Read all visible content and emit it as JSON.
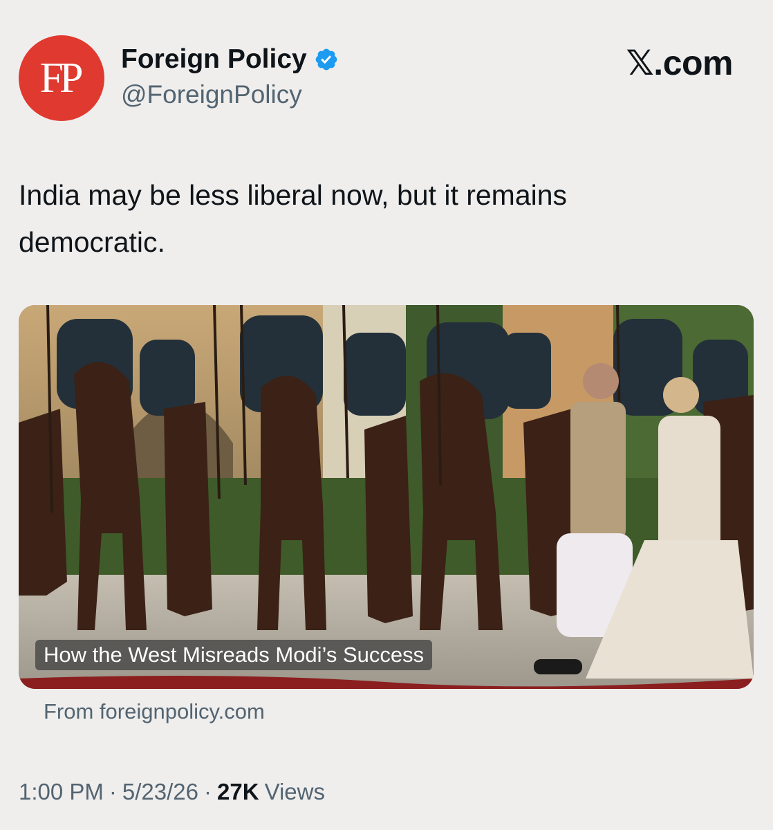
{
  "author": {
    "avatar_text": "FP",
    "display_name": "Foreign Policy",
    "handle": "@ForeignPolicy",
    "verified": true
  },
  "site_logo": "𝕏.com",
  "tweet": {
    "text": "India may be less liberal now, but it remains democratic."
  },
  "card": {
    "title": "How the West Misreads Modi’s Success",
    "source": "From foreignpolicy.com"
  },
  "meta": {
    "time": "1:00 PM",
    "separator": "·",
    "date": "5/23/26",
    "views_count": "27K",
    "views_label": "Views"
  },
  "colors": {
    "background": "#efeeed",
    "avatar": "#e0392f",
    "verified_badge": "#1d9bf0",
    "secondary_text": "#536471",
    "primary_text": "#0f1419"
  }
}
